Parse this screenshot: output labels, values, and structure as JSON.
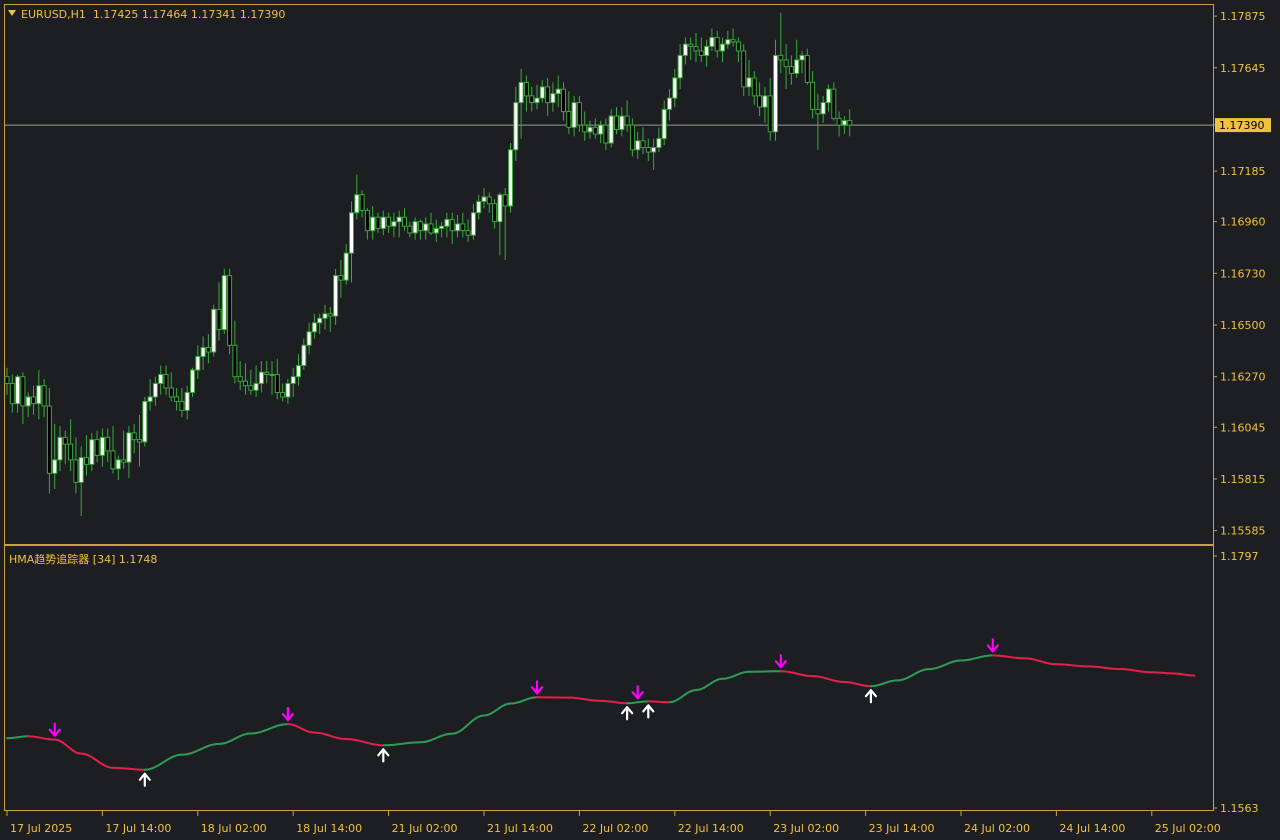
{
  "header": {
    "symbol": "EURUSD,H1",
    "ohlc": "1.17425 1.17464 1.17341 1.17390"
  },
  "indicator": {
    "label": "HMA趋势追踪器 [34] 1.1748"
  },
  "colors": {
    "background": "#1d1e22",
    "frame": "#c8a23c",
    "axis_text": "#f0c040",
    "candle": "#3aa83a",
    "candle_bull_fill": "#ffffff",
    "bid_line": "#9a9a9a",
    "hma_up": "#2e9a58",
    "hma_down": "#e0204c",
    "arrow_down": "#ff00ff",
    "arrow_up": "#ffffff"
  },
  "chart_data": [
    {
      "type": "candlestick",
      "title": "EURUSD,H1",
      "bid": 1.1739,
      "ylim": [
        1.1553,
        1.1792
      ],
      "price_ticks": [
        "1.17875",
        "1.17645",
        "1.17390",
        "1.17185",
        "1.16960",
        "1.16730",
        "1.16500",
        "1.16270",
        "1.16045",
        "1.15815",
        "1.15585"
      ],
      "bid_label": "1.17390",
      "candles": [
        [
          1.1627,
          1.1631,
          1.1619,
          1.1624
        ],
        [
          1.1624,
          1.1628,
          1.1611,
          1.1615
        ],
        [
          1.1615,
          1.1628,
          1.1611,
          1.1627
        ],
        [
          1.1627,
          1.1629,
          1.1606,
          1.1614
        ],
        [
          1.1614,
          1.162,
          1.1609,
          1.1618
        ],
        [
          1.1618,
          1.1623,
          1.161,
          1.1615
        ],
        [
          1.1615,
          1.163,
          1.1608,
          1.1623
        ],
        [
          1.1623,
          1.1626,
          1.1609,
          1.1614
        ],
        [
          1.1614,
          1.1622,
          1.1575,
          1.1584
        ],
        [
          1.1584,
          1.1606,
          1.1577,
          1.159
        ],
        [
          1.159,
          1.1605,
          1.1585,
          1.16
        ],
        [
          1.16,
          1.1603,
          1.1588,
          1.1597
        ],
        [
          1.1597,
          1.1608,
          1.1585,
          1.159
        ],
        [
          1.159,
          1.16,
          1.1575,
          1.158
        ],
        [
          1.158,
          1.1596,
          1.1565,
          1.1591
        ],
        [
          1.1591,
          1.1601,
          1.1583,
          1.1588
        ],
        [
          1.1588,
          1.1602,
          1.1585,
          1.1599
        ],
        [
          1.1599,
          1.1603,
          1.1589,
          1.1592
        ],
        [
          1.1592,
          1.1604,
          1.1587,
          1.16
        ],
        [
          1.16,
          1.1604,
          1.1589,
          1.1594
        ],
        [
          1.1594,
          1.1605,
          1.1584,
          1.1586
        ],
        [
          1.1586,
          1.1592,
          1.1581,
          1.159
        ],
        [
          1.159,
          1.1603,
          1.1586,
          1.1589
        ],
        [
          1.1589,
          1.1605,
          1.1582,
          1.1602
        ],
        [
          1.1602,
          1.1606,
          1.1593,
          1.1599
        ],
        [
          1.1599,
          1.161,
          1.1587,
          1.1598
        ],
        [
          1.1598,
          1.1618,
          1.1596,
          1.1616
        ],
        [
          1.1616,
          1.1626,
          1.1612,
          1.1618
        ],
        [
          1.1618,
          1.1627,
          1.1614,
          1.1624
        ],
        [
          1.1624,
          1.1632,
          1.1619,
          1.1628
        ],
        [
          1.1628,
          1.1632,
          1.1619,
          1.1622
        ],
        [
          1.1622,
          1.1629,
          1.1616,
          1.1618
        ],
        [
          1.1618,
          1.1622,
          1.1612,
          1.1616
        ],
        [
          1.1616,
          1.1622,
          1.1609,
          1.1612
        ],
        [
          1.1612,
          1.1623,
          1.1608,
          1.162
        ],
        [
          1.162,
          1.1631,
          1.1618,
          1.163
        ],
        [
          1.163,
          1.1641,
          1.1626,
          1.1636
        ],
        [
          1.1636,
          1.1645,
          1.163,
          1.164
        ],
        [
          1.164,
          1.1646,
          1.1633,
          1.1638
        ],
        [
          1.1638,
          1.1659,
          1.1636,
          1.1657
        ],
        [
          1.1657,
          1.1669,
          1.1643,
          1.1648
        ],
        [
          1.1648,
          1.1675,
          1.1646,
          1.1672
        ],
        [
          1.1672,
          1.1675,
          1.1637,
          1.1641
        ],
        [
          1.1641,
          1.1652,
          1.1624,
          1.1627
        ],
        [
          1.1627,
          1.1634,
          1.1621,
          1.1625
        ],
        [
          1.1625,
          1.1633,
          1.1619,
          1.1623
        ],
        [
          1.1623,
          1.163,
          1.1619,
          1.1621
        ],
        [
          1.1621,
          1.1632,
          1.1618,
          1.1624
        ],
        [
          1.1624,
          1.1634,
          1.162,
          1.1629
        ],
        [
          1.1629,
          1.1634,
          1.1624,
          1.1628
        ],
        [
          1.1628,
          1.1634,
          1.1619,
          1.1628
        ],
        [
          1.1628,
          1.1635,
          1.1617,
          1.162
        ],
        [
          1.162,
          1.1624,
          1.1616,
          1.1618
        ],
        [
          1.1618,
          1.1626,
          1.1615,
          1.1624
        ],
        [
          1.1624,
          1.1631,
          1.1618,
          1.1627
        ],
        [
          1.1627,
          1.1637,
          1.1623,
          1.1632
        ],
        [
          1.1632,
          1.1644,
          1.163,
          1.1641
        ],
        [
          1.1641,
          1.1651,
          1.1637,
          1.1647
        ],
        [
          1.1647,
          1.1655,
          1.1644,
          1.1651
        ],
        [
          1.1651,
          1.1655,
          1.1646,
          1.1653
        ],
        [
          1.1653,
          1.1659,
          1.1648,
          1.1655
        ],
        [
          1.1655,
          1.1658,
          1.1647,
          1.1654
        ],
        [
          1.1654,
          1.1675,
          1.165,
          1.1672
        ],
        [
          1.1672,
          1.1679,
          1.1662,
          1.167
        ],
        [
          1.167,
          1.1686,
          1.1668,
          1.1682
        ],
        [
          1.1682,
          1.1705,
          1.1669,
          1.17
        ],
        [
          1.17,
          1.1717,
          1.1697,
          1.1708
        ],
        [
          1.1708,
          1.171,
          1.1698,
          1.1701
        ],
        [
          1.1701,
          1.1702,
          1.1688,
          1.1692
        ],
        [
          1.1692,
          1.1703,
          1.1688,
          1.1698
        ],
        [
          1.1698,
          1.17,
          1.1691,
          1.1693
        ],
        [
          1.1693,
          1.1701,
          1.169,
          1.1698
        ],
        [
          1.1698,
          1.17,
          1.1691,
          1.1694
        ],
        [
          1.1694,
          1.17,
          1.1689,
          1.1696
        ],
        [
          1.1696,
          1.1701,
          1.1689,
          1.1698
        ],
        [
          1.1698,
          1.1702,
          1.1692,
          1.1694
        ],
        [
          1.1694,
          1.1696,
          1.1689,
          1.1691
        ],
        [
          1.1691,
          1.1698,
          1.1688,
          1.1696
        ],
        [
          1.1696,
          1.1697,
          1.1688,
          1.1692
        ],
        [
          1.1692,
          1.1698,
          1.1688,
          1.1695
        ],
        [
          1.1695,
          1.17,
          1.169,
          1.1691
        ],
        [
          1.1691,
          1.1697,
          1.1687,
          1.1693
        ],
        [
          1.1693,
          1.1696,
          1.1689,
          1.1694
        ],
        [
          1.1694,
          1.17,
          1.1689,
          1.1697
        ],
        [
          1.1697,
          1.17,
          1.1686,
          1.1692
        ],
        [
          1.1692,
          1.1699,
          1.1689,
          1.1695
        ],
        [
          1.1695,
          1.17,
          1.1689,
          1.1692
        ],
        [
          1.1692,
          1.1697,
          1.1687,
          1.169
        ],
        [
          1.169,
          1.1704,
          1.1688,
          1.17
        ],
        [
          1.17,
          1.1708,
          1.1697,
          1.1705
        ],
        [
          1.1705,
          1.1711,
          1.1702,
          1.1707
        ],
        [
          1.1707,
          1.1709,
          1.17,
          1.1704
        ],
        [
          1.1704,
          1.1706,
          1.1693,
          1.1696
        ],
        [
          1.1696,
          1.1709,
          1.1681,
          1.1708
        ],
        [
          1.1708,
          1.1711,
          1.1679,
          1.1703
        ],
        [
          1.1703,
          1.1731,
          1.17,
          1.1728
        ],
        [
          1.1728,
          1.1756,
          1.1723,
          1.1749
        ],
        [
          1.1749,
          1.1764,
          1.1733,
          1.1758
        ],
        [
          1.1758,
          1.1761,
          1.1745,
          1.1752
        ],
        [
          1.1752,
          1.1756,
          1.1745,
          1.1749
        ],
        [
          1.1749,
          1.1757,
          1.1746,
          1.1751
        ],
        [
          1.1751,
          1.1759,
          1.1749,
          1.1756
        ],
        [
          1.1756,
          1.176,
          1.1743,
          1.1749
        ],
        [
          1.1749,
          1.1758,
          1.1745,
          1.1753
        ],
        [
          1.1753,
          1.1761,
          1.1747,
          1.1755
        ],
        [
          1.1755,
          1.1758,
          1.1741,
          1.1745
        ],
        [
          1.1745,
          1.1754,
          1.1735,
          1.1738
        ],
        [
          1.1738,
          1.1752,
          1.1734,
          1.1749
        ],
        [
          1.1749,
          1.1752,
          1.1736,
          1.1739
        ],
        [
          1.1739,
          1.1745,
          1.1732,
          1.1736
        ],
        [
          1.1736,
          1.1741,
          1.1733,
          1.1738
        ],
        [
          1.1738,
          1.1742,
          1.1733,
          1.1735
        ],
        [
          1.1735,
          1.1741,
          1.1731,
          1.1739
        ],
        [
          1.1739,
          1.1742,
          1.1728,
          1.1731
        ],
        [
          1.1731,
          1.1746,
          1.1729,
          1.1743
        ],
        [
          1.1743,
          1.1747,
          1.1735,
          1.1737
        ],
        [
          1.1737,
          1.1747,
          1.1734,
          1.1743
        ],
        [
          1.1743,
          1.175,
          1.1736,
          1.1739
        ],
        [
          1.1739,
          1.1742,
          1.1725,
          1.1728
        ],
        [
          1.1728,
          1.1736,
          1.1724,
          1.1732
        ],
        [
          1.1732,
          1.1738,
          1.1726,
          1.1729
        ],
        [
          1.1729,
          1.1733,
          1.1723,
          1.1727
        ],
        [
          1.1727,
          1.1733,
          1.1719,
          1.1729
        ],
        [
          1.1729,
          1.1738,
          1.1727,
          1.1733
        ],
        [
          1.1733,
          1.175,
          1.173,
          1.1746
        ],
        [
          1.1746,
          1.1755,
          1.1741,
          1.1751
        ],
        [
          1.1751,
          1.1764,
          1.1747,
          1.176
        ],
        [
          1.176,
          1.1775,
          1.1755,
          1.177
        ],
        [
          1.177,
          1.1778,
          1.1766,
          1.1775
        ],
        [
          1.1775,
          1.1778,
          1.1768,
          1.1774
        ],
        [
          1.1774,
          1.178,
          1.1767,
          1.1772
        ],
        [
          1.1772,
          1.1778,
          1.1767,
          1.177
        ],
        [
          1.177,
          1.1777,
          1.1765,
          1.1774
        ],
        [
          1.1774,
          1.1782,
          1.1772,
          1.1778
        ],
        [
          1.1778,
          1.1781,
          1.1769,
          1.1772
        ],
        [
          1.1772,
          1.1778,
          1.1767,
          1.1775
        ],
        [
          1.1775,
          1.1781,
          1.1773,
          1.1777
        ],
        [
          1.1777,
          1.1782,
          1.1774,
          1.1776
        ],
        [
          1.1776,
          1.1778,
          1.1767,
          1.1772
        ],
        [
          1.1772,
          1.1775,
          1.1752,
          1.1756
        ],
        [
          1.1756,
          1.1768,
          1.1752,
          1.176
        ],
        [
          1.176,
          1.1763,
          1.1748,
          1.1752
        ],
        [
          1.1752,
          1.1758,
          1.1743,
          1.1747
        ],
        [
          1.1747,
          1.1756,
          1.174,
          1.1752
        ],
        [
          1.1752,
          1.176,
          1.1732,
          1.1736
        ],
        [
          1.1736,
          1.1777,
          1.1732,
          1.177
        ],
        [
          1.177,
          1.1789,
          1.1762,
          1.1768
        ],
        [
          1.1768,
          1.1775,
          1.1755,
          1.1765
        ],
        [
          1.1765,
          1.177,
          1.1757,
          1.1762
        ],
        [
          1.1762,
          1.1777,
          1.176,
          1.1768
        ],
        [
          1.1768,
          1.1772,
          1.1762,
          1.177
        ],
        [
          1.177,
          1.1773,
          1.1757,
          1.1758
        ],
        [
          1.1758,
          1.1763,
          1.1742,
          1.1746
        ],
        [
          1.1746,
          1.1753,
          1.1728,
          1.1744
        ],
        [
          1.1744,
          1.1752,
          1.174,
          1.1749
        ],
        [
          1.1749,
          1.1757,
          1.1745,
          1.1755
        ],
        [
          1.1755,
          1.1758,
          1.1741,
          1.1742
        ],
        [
          1.1742,
          1.1745,
          1.1734,
          1.1739
        ],
        [
          1.1739,
          1.1743,
          1.1735,
          1.1741
        ],
        [
          1.1741,
          1.1746,
          1.1734,
          1.1739
        ]
      ]
    },
    {
      "type": "line",
      "title": "HMA趋势追踪器 [34] 1.1748",
      "ylim": [
        1.1563,
        1.1797
      ],
      "y_ticks": [
        "1.1797",
        "1.1563"
      ],
      "x_ticks": [
        "17 Jul 2025",
        "17 Jul 14:00",
        "18 Jul 02:00",
        "18 Jul 14:00",
        "21 Jul 02:00",
        "21 Jul 14:00",
        "22 Jul 02:00",
        "22 Jul 14:00",
        "23 Jul 02:00",
        "23 Jul 14:00",
        "24 Jul 02:00",
        "24 Jul 14:00",
        "25 Jul 02:00"
      ],
      "hma_knots": [
        [
          0,
          1.16278
        ],
        [
          4,
          1.16296
        ],
        [
          9,
          1.16265
        ],
        [
          14,
          1.16135
        ],
        [
          20,
          1.16003
        ],
        [
          26,
          1.15985
        ],
        [
          33,
          1.16125
        ],
        [
          40,
          1.16225
        ],
        [
          46,
          1.16322
        ],
        [
          53,
          1.16409
        ],
        [
          58,
          1.1633
        ],
        [
          64,
          1.1627
        ],
        [
          71,
          1.16212
        ],
        [
          78,
          1.1624
        ],
        [
          84,
          1.1632
        ],
        [
          90,
          1.16489
        ],
        [
          95,
          1.166
        ],
        [
          100,
          1.16658
        ],
        [
          106,
          1.16655
        ],
        [
          112,
          1.16625
        ],
        [
          117,
          1.16603
        ],
        [
          121,
          1.1662
        ],
        [
          125,
          1.16612
        ],
        [
          130,
          1.16725
        ],
        [
          135,
          1.1683
        ],
        [
          140,
          1.16895
        ],
        [
          146,
          1.169
        ],
        [
          152,
          1.16855
        ],
        [
          158,
          1.168
        ],
        [
          163,
          1.16761
        ],
        [
          168,
          1.16815
        ],
        [
          174,
          1.1692
        ],
        [
          180,
          1.17
        ],
        [
          186,
          1.17047
        ],
        [
          192,
          1.1702
        ],
        [
          198,
          1.16965
        ],
        [
          204,
          1.16945
        ],
        [
          210,
          1.1692
        ],
        [
          216,
          1.1689
        ],
        [
          220,
          1.1688
        ],
        [
          224,
          1.1686
        ]
      ],
      "turn_points": [
        {
          "bar": 9,
          "dir": "down"
        },
        {
          "bar": 26,
          "dir": "up"
        },
        {
          "bar": 53,
          "dir": "down"
        },
        {
          "bar": 71,
          "dir": "up"
        },
        {
          "bar": 100,
          "dir": "down"
        },
        {
          "bar": 117,
          "dir": "up"
        },
        {
          "bar": 119,
          "dir": "down"
        },
        {
          "bar": 121,
          "dir": "up"
        },
        {
          "bar": 146,
          "dir": "down"
        },
        {
          "bar": 163,
          "dir": "up"
        },
        {
          "bar": 186,
          "dir": "down"
        }
      ]
    }
  ]
}
